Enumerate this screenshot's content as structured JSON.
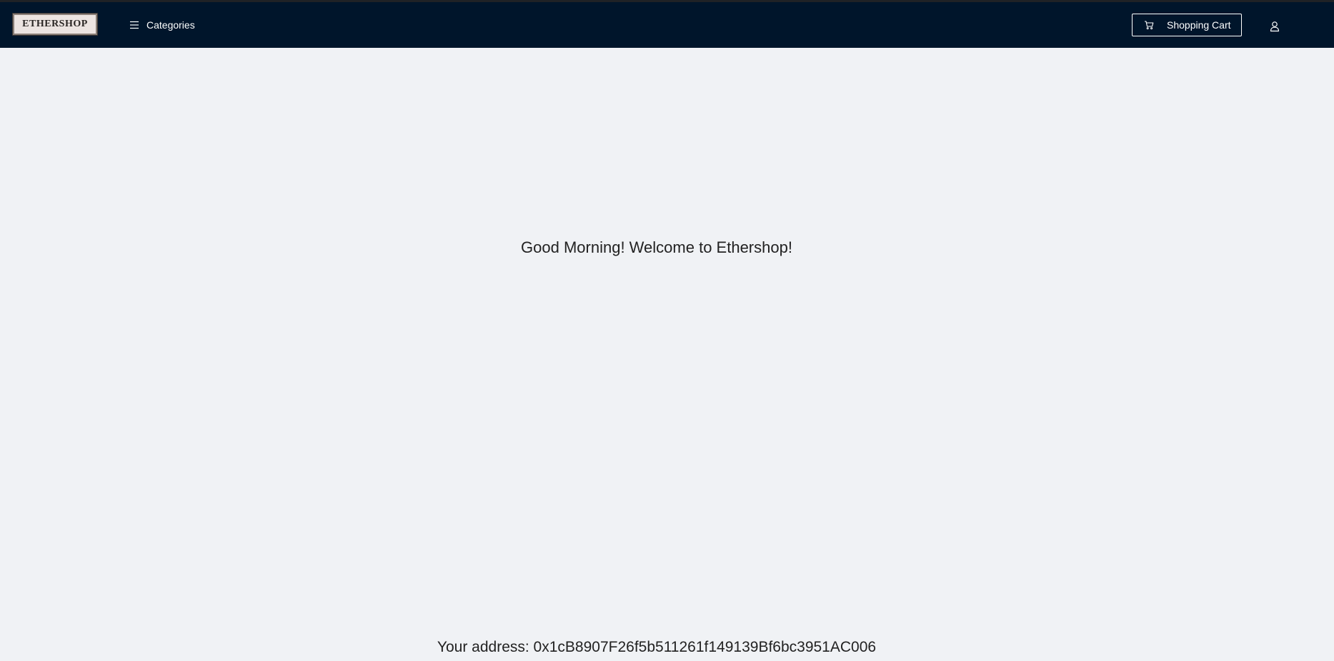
{
  "header": {
    "logo_text": "ETHERSHOP",
    "categories_label": "Categories",
    "cart_label": "Shopping Cart",
    "icons": {
      "menu": "menu-icon",
      "cart": "shopping-cart-icon",
      "user": "user-icon"
    }
  },
  "main": {
    "welcome_text": "Good Morning! Welcome to Ethershop!",
    "address_text": "Your address: 0x1cB8907F26f5b511261f149139Bf6bc3951AC006"
  },
  "colors": {
    "navbar_bg": "#00152b",
    "page_bg": "#f0f2f5",
    "text": "#222222"
  }
}
